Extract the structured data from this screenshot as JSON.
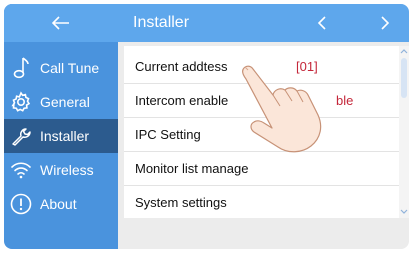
{
  "header": {
    "back_icon": "back-arrow-icon",
    "title": "Installer"
  },
  "sidebar": {
    "items": [
      {
        "label": "Call Tune",
        "icon": "music-note-icon"
      },
      {
        "label": "General",
        "icon": "gear-icon"
      },
      {
        "label": "Installer",
        "icon": "wrench-icon",
        "active": true
      },
      {
        "label": "Wireless",
        "icon": "wifi-icon"
      },
      {
        "label": "About",
        "icon": "info-icon"
      }
    ]
  },
  "settings": {
    "rows": [
      {
        "label": "Current addtess",
        "value": "[01]"
      },
      {
        "label": "Intercom enable",
        "value": "ble"
      },
      {
        "label": "IPC Setting"
      },
      {
        "label": "Monitor list manage"
      },
      {
        "label": "System settings"
      }
    ]
  },
  "colors": {
    "header_bg": "#5ea7ec",
    "sidebar_bg": "#4a93dd",
    "sidebar_active": "#2c5b8e",
    "value_red": "#c4273a"
  }
}
